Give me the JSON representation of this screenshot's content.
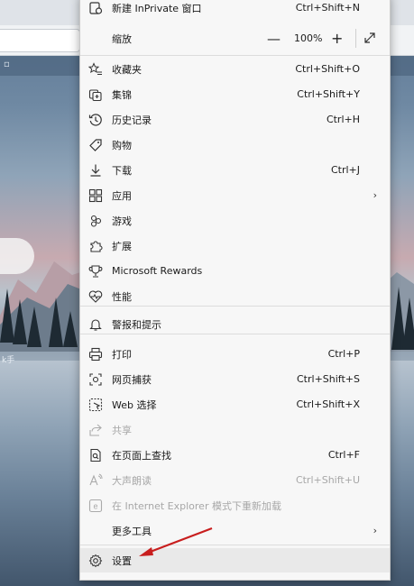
{
  "menu": {
    "items": [
      {
        "label": "新建 InPrivate 窗口",
        "shortcut": "Ctrl+Shift+N",
        "icon": "inprivate-window-icon",
        "disabled": false,
        "submenu": false
      },
      {
        "label": "缩放",
        "shortcut": "",
        "icon": "",
        "disabled": false,
        "submenu": false
      },
      {
        "label": "收藏夹",
        "shortcut": "Ctrl+Shift+O",
        "icon": "star-list-icon",
        "disabled": false,
        "submenu": false
      },
      {
        "label": "集锦",
        "shortcut": "Ctrl+Shift+Y",
        "icon": "collections-icon",
        "disabled": false,
        "submenu": false
      },
      {
        "label": "历史记录",
        "shortcut": "Ctrl+H",
        "icon": "history-icon",
        "disabled": false,
        "submenu": false
      },
      {
        "label": "购物",
        "shortcut": "",
        "icon": "tag-icon",
        "disabled": false,
        "submenu": false
      },
      {
        "label": "下载",
        "shortcut": "Ctrl+J",
        "icon": "download-icon",
        "disabled": false,
        "submenu": false
      },
      {
        "label": "应用",
        "shortcut": "",
        "icon": "apps-icon",
        "disabled": false,
        "submenu": true
      },
      {
        "label": "游戏",
        "shortcut": "",
        "icon": "game-icon",
        "disabled": false,
        "submenu": false
      },
      {
        "label": "扩展",
        "shortcut": "",
        "icon": "puzzle-icon",
        "disabled": false,
        "submenu": false
      },
      {
        "label": "Microsoft Rewards",
        "shortcut": "",
        "icon": "trophy-icon",
        "disabled": false,
        "submenu": false
      },
      {
        "label": "性能",
        "shortcut": "",
        "icon": "heart-pulse-icon",
        "disabled": false,
        "submenu": false
      },
      {
        "label": "警报和提示",
        "shortcut": "",
        "icon": "bell-icon",
        "disabled": false,
        "submenu": false
      },
      {
        "label": "打印",
        "shortcut": "Ctrl+P",
        "icon": "printer-icon",
        "disabled": false,
        "submenu": false
      },
      {
        "label": "网页捕获",
        "shortcut": "Ctrl+Shift+S",
        "icon": "capture-icon",
        "disabled": false,
        "submenu": false
      },
      {
        "label": "Web 选择",
        "shortcut": "Ctrl+Shift+X",
        "icon": "web-select-icon",
        "disabled": false,
        "submenu": false
      },
      {
        "label": "共享",
        "shortcut": "",
        "icon": "share-icon",
        "disabled": true,
        "submenu": false
      },
      {
        "label": "在页面上查找",
        "shortcut": "Ctrl+F",
        "icon": "find-icon",
        "disabled": false,
        "submenu": false
      },
      {
        "label": "大声朗读",
        "shortcut": "Ctrl+Shift+U",
        "icon": "read-aloud-icon",
        "disabled": true,
        "submenu": false
      },
      {
        "label": "在 Internet Explorer 模式下重新加载",
        "shortcut": "",
        "icon": "ie-mode-icon",
        "disabled": true,
        "submenu": false
      },
      {
        "label": "更多工具",
        "shortcut": "",
        "icon": "",
        "disabled": false,
        "submenu": true
      },
      {
        "label": "设置",
        "shortcut": "",
        "icon": "gear-icon",
        "disabled": false,
        "submenu": false
      }
    ],
    "zoom": {
      "minus": "—",
      "value": "100%",
      "plus": "+"
    }
  },
  "background": {
    "partial_text": "k手"
  },
  "colors": {
    "menu_bg": "#f7f7f7",
    "arrow": "#c81e1e",
    "highlight": "#e9e9e9"
  }
}
